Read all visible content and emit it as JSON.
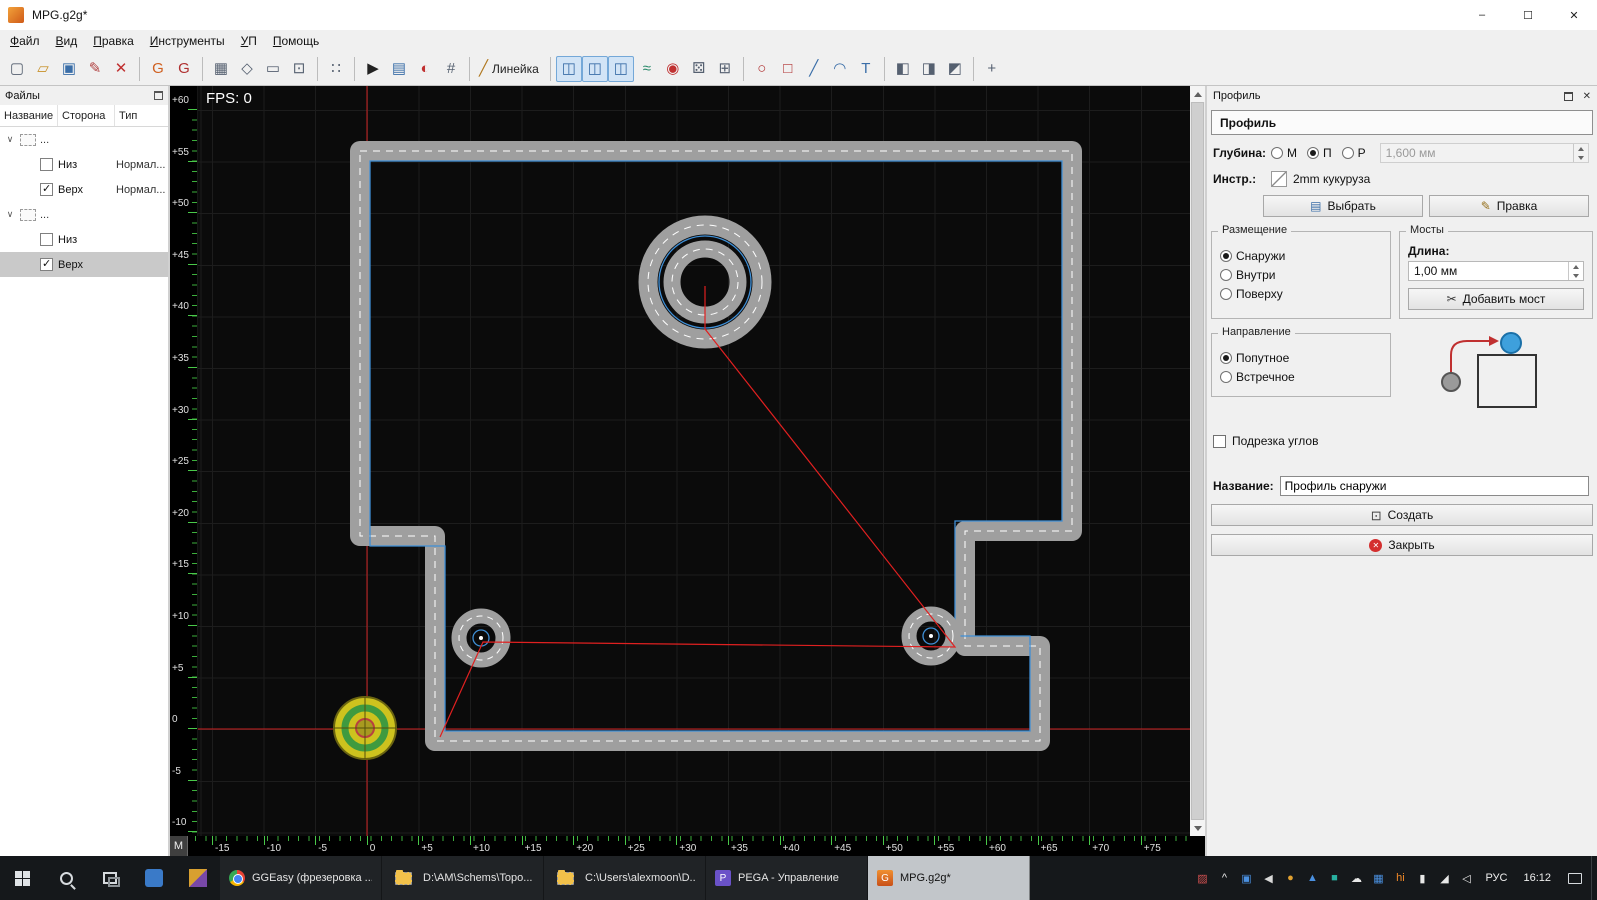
{
  "window": {
    "title": "MPG.g2g*",
    "minimize": "–",
    "maximize": "☐",
    "close": "✕"
  },
  "menu": [
    "Файл",
    "Вид",
    "Правка",
    "Инструменты",
    "УП",
    "Помощь"
  ],
  "toolbar": {
    "groups": [
      [
        {
          "name": "new-file",
          "glyph": "▢",
          "color": "#556070"
        },
        {
          "name": "open-file",
          "glyph": "▱",
          "color": "#c89028"
        },
        {
          "name": "save-file",
          "glyph": "▣",
          "color": "#3a6ea8"
        },
        {
          "name": "save-as",
          "glyph": "✎",
          "color": "#b04040"
        },
        {
          "name": "close-file",
          "glyph": "✕",
          "color": "#c03030"
        }
      ],
      [
        {
          "name": "gcode-bottom",
          "glyph": "G",
          "color": "#d06020"
        },
        {
          "name": "gcode-top",
          "glyph": "G",
          "color": "#b03030"
        }
      ],
      [
        {
          "name": "select-rect",
          "glyph": "▦",
          "color": "#556070"
        },
        {
          "name": "transform",
          "glyph": "◇",
          "color": "#556070"
        },
        {
          "name": "zoom-window",
          "glyph": "▭",
          "color": "#556070"
        },
        {
          "name": "zoom-fit",
          "glyph": "⊡",
          "color": "#556070"
        }
      ],
      [
        {
          "name": "snap-grid",
          "glyph": "∷",
          "color": "#556070"
        }
      ],
      [
        {
          "name": "run-gcode",
          "glyph": "▶",
          "color": "#222222"
        },
        {
          "name": "gcode-table",
          "glyph": "▤",
          "color": "#3a6ea8"
        },
        {
          "name": "statistics-pie",
          "glyph": "◐",
          "color": "#c03030"
        },
        {
          "name": "drill-grid",
          "glyph": "#",
          "color": "#556070"
        }
      ],
      [
        {
          "name": "ruler",
          "glyph": "╱",
          "color": "#b07820",
          "label": "Линейка"
        }
      ],
      [
        {
          "name": "view-toggle-borders",
          "glyph": "◫",
          "color": "#3a6ea8",
          "toggled": true
        },
        {
          "name": "view-toggle-paths",
          "glyph": "◫",
          "color": "#3a6ea8",
          "toggled": true
        },
        {
          "name": "view-toggle-fills",
          "glyph": "◫",
          "color": "#3a6ea8",
          "toggled": true
        },
        {
          "name": "smooth-curve",
          "glyph": "≈",
          "color": "#2a8a6a"
        },
        {
          "name": "marker-red",
          "glyph": "◉",
          "color": "#c03030"
        },
        {
          "name": "dice",
          "glyph": "⚄",
          "color": "#556070"
        },
        {
          "name": "pixel-grid",
          "glyph": "⊞",
          "color": "#556070"
        }
      ],
      [
        {
          "name": "draw-circle",
          "glyph": "○",
          "color": "#b03030"
        },
        {
          "name": "draw-rect",
          "glyph": "□",
          "color": "#b03030"
        },
        {
          "name": "draw-line",
          "glyph": "╱",
          "color": "#3a6ea8"
        },
        {
          "name": "draw-arc",
          "glyph": "◠",
          "color": "#3a6ea8"
        },
        {
          "name": "draw-text",
          "glyph": "T",
          "color": "#3a6ea8"
        }
      ],
      [
        {
          "name": "bool-union",
          "glyph": "◧",
          "color": "#556070"
        },
        {
          "name": "bool-subtract",
          "glyph": "◨",
          "color": "#556070"
        },
        {
          "name": "bool-intersect",
          "glyph": "◩",
          "color": "#556070"
        }
      ],
      [
        {
          "name": "snap-points",
          "glyph": "+",
          "color": "#556070"
        }
      ]
    ]
  },
  "files_panel": {
    "title": "Файлы",
    "columns": [
      "Название",
      "Сторона",
      "Тип"
    ],
    "rows": [
      {
        "kind": "group",
        "label": "..."
      },
      {
        "kind": "item",
        "label": "Низ",
        "checked": false,
        "type": "Нормал..."
      },
      {
        "kind": "item",
        "label": "Верх",
        "checked": true,
        "type": "Нормал..."
      },
      {
        "kind": "group",
        "label": "..."
      },
      {
        "kind": "item",
        "label": "Низ",
        "checked": false,
        "type": ""
      },
      {
        "kind": "item",
        "label": "Верх",
        "checked": true,
        "type": "",
        "selected": true
      }
    ]
  },
  "canvas": {
    "fps": "FPS: 0",
    "corner_label": "M",
    "v_ruler": [
      "+60",
      "+55",
      "+50",
      "+45",
      "+40",
      "+35",
      "+30",
      "+25",
      "+20",
      "+15",
      "+10",
      "+5",
      "0",
      "-5",
      "-10"
    ],
    "h_ruler": [
      "-15",
      "-10",
      "-5",
      "0",
      "+5",
      "+10",
      "+15",
      "+20",
      "+25",
      "+30",
      "+35",
      "+40",
      "+45",
      "+50",
      "+55",
      "+60",
      "+65",
      "+70",
      "+75"
    ]
  },
  "profile_panel": {
    "dock_title": "Профиль",
    "section_title": "Профиль",
    "depth": {
      "label": "Глубина:",
      "options": [
        {
          "label": "М",
          "checked": false
        },
        {
          "label": "П",
          "checked": true
        },
        {
          "label": "Р",
          "checked": false
        }
      ],
      "value": "1,600 мм"
    },
    "tool": {
      "label": "Инстр.:",
      "value": "2mm кукуруза"
    },
    "select_button": "Выбрать",
    "edit_button": "Правка",
    "placement": {
      "title": "Размещение",
      "options": [
        {
          "label": "Снаружи",
          "checked": true
        },
        {
          "label": "Внутри",
          "checked": false
        },
        {
          "label": "Поверху",
          "checked": false
        }
      ]
    },
    "bridges": {
      "title": "Мосты",
      "length_label": "Длина:",
      "length_value": "1,00 мм",
      "add_button": "Добавить мост"
    },
    "direction": {
      "title": "Направление",
      "options": [
        {
          "label": "Попутное",
          "checked": true
        },
        {
          "label": "Встречное",
          "checked": false
        }
      ]
    },
    "corner_trim": {
      "label": "Подрезка углов",
      "checked": false
    },
    "name": {
      "label": "Название:",
      "value": "Профиль снаружи"
    },
    "create_button": "Создать",
    "close_button": "Закрыть"
  },
  "taskbar": {
    "items": [
      {
        "name": "task-chrome-ggeasy",
        "label": "GGEasy (фрезеровка ...",
        "icon": "chrome"
      },
      {
        "name": "task-explorer-d-drive",
        "label": "D:\\AM\\Schems\\Topo...",
        "icon": "folder"
      },
      {
        "name": "task-explorer-c-users",
        "label": "C:\\Users\\alexmoon\\D...",
        "icon": "folder"
      },
      {
        "name": "task-pega",
        "label": "PEGA - Управление",
        "icon": "pega",
        "glyph": "P"
      },
      {
        "name": "task-mpg-g2g",
        "label": "MPG.g2g*",
        "icon": "gg",
        "glyph": "G",
        "active": true
      }
    ],
    "tray": [
      {
        "name": "tray-app-photos",
        "glyph": "▨",
        "color": "#d05050"
      },
      {
        "name": "hidden-icons-chevron",
        "glyph": "^",
        "color": "#e8e8e8"
      },
      {
        "name": "tray-app-blue",
        "glyph": "▣",
        "color": "#4a90e0"
      },
      {
        "name": "tray-volume-alt",
        "glyph": "◀",
        "color": "#d8d8d8"
      },
      {
        "name": "tray-app-ball",
        "glyph": "●",
        "color": "#e0a030"
      },
      {
        "name": "tray-defender-shield",
        "glyph": "▲",
        "color": "#4a90e0"
      },
      {
        "name": "tray-app-teal",
        "glyph": "■",
        "color": "#28b0a0"
      },
      {
        "name": "tray-onedrive-cloud",
        "glyph": "☁",
        "color": "#e8e8e8"
      },
      {
        "name": "tray-app-grid",
        "glyph": "▦",
        "color": "#4a90e0"
      },
      {
        "name": "tray-hi-app",
        "glyph": "hi",
        "color": "#f08828"
      },
      {
        "name": "tray-battery",
        "glyph": "▮",
        "color": "#e8e8e8"
      },
      {
        "name": "tray-network",
        "glyph": "◢",
        "color": "#e8e8e8"
      },
      {
        "name": "tray-volume",
        "glyph": "◁",
        "color": "#e8e8e8"
      }
    ],
    "lang": "РУС",
    "time": "16:12"
  }
}
